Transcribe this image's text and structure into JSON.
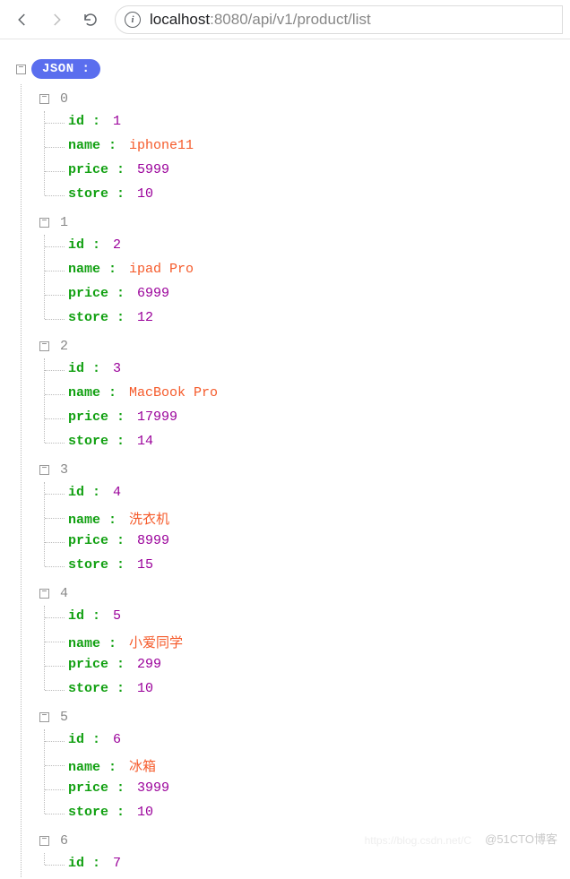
{
  "nav": {
    "url_host": "localhost",
    "url_port_path": ":8080/api/v1/product/list"
  },
  "root_label": "JSON :",
  "items": [
    {
      "idx": "0",
      "props": [
        {
          "key": "id",
          "val": "1",
          "t": "num"
        },
        {
          "key": "name",
          "val": "iphone11",
          "t": "str"
        },
        {
          "key": "price",
          "val": "5999",
          "t": "num"
        },
        {
          "key": "store",
          "val": "10",
          "t": "num"
        }
      ]
    },
    {
      "idx": "1",
      "props": [
        {
          "key": "id",
          "val": "2",
          "t": "num"
        },
        {
          "key": "name",
          "val": "ipad Pro",
          "t": "str"
        },
        {
          "key": "price",
          "val": "6999",
          "t": "num"
        },
        {
          "key": "store",
          "val": "12",
          "t": "num"
        }
      ]
    },
    {
      "idx": "2",
      "props": [
        {
          "key": "id",
          "val": "3",
          "t": "num"
        },
        {
          "key": "name",
          "val": "MacBook Pro",
          "t": "str"
        },
        {
          "key": "price",
          "val": "17999",
          "t": "num"
        },
        {
          "key": "store",
          "val": "14",
          "t": "num"
        }
      ]
    },
    {
      "idx": "3",
      "props": [
        {
          "key": "id",
          "val": "4",
          "t": "num"
        },
        {
          "key": "name",
          "val": "洗衣机",
          "t": "str"
        },
        {
          "key": "price",
          "val": "8999",
          "t": "num"
        },
        {
          "key": "store",
          "val": "15",
          "t": "num"
        }
      ]
    },
    {
      "idx": "4",
      "props": [
        {
          "key": "id",
          "val": "5",
          "t": "num"
        },
        {
          "key": "name",
          "val": "小爱同学",
          "t": "str"
        },
        {
          "key": "price",
          "val": "299",
          "t": "num"
        },
        {
          "key": "store",
          "val": "10",
          "t": "num"
        }
      ]
    },
    {
      "idx": "5",
      "props": [
        {
          "key": "id",
          "val": "6",
          "t": "num"
        },
        {
          "key": "name",
          "val": "冰箱",
          "t": "str"
        },
        {
          "key": "price",
          "val": "3999",
          "t": "num"
        },
        {
          "key": "store",
          "val": "10",
          "t": "num"
        }
      ]
    },
    {
      "idx": "6",
      "props": [
        {
          "key": "id",
          "val": "7",
          "t": "num"
        }
      ]
    }
  ],
  "watermark": "@51CTO博客",
  "faint_url": "https://blog.csdn.net/C"
}
